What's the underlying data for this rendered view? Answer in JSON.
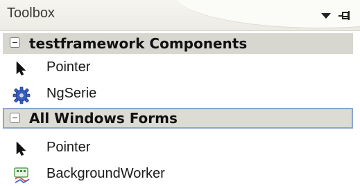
{
  "window": {
    "title": "Toolbox"
  },
  "groups": [
    {
      "label": "testframework Components",
      "items": [
        {
          "label": "Pointer",
          "icon": "pointer-arrow-icon"
        },
        {
          "label": "NgSerie",
          "icon": "gear-component-icon"
        }
      ]
    },
    {
      "label": "All Windows Forms",
      "selected": true,
      "items": [
        {
          "label": "Pointer",
          "icon": "pointer-arrow-icon"
        },
        {
          "label": "BackgroundWorker",
          "icon": "background-worker-icon"
        }
      ]
    }
  ],
  "colors": {
    "group_header_bg": "#d7d6cf",
    "selected_border": "#8aa6cf",
    "gear_blue": "#3b5fc4"
  }
}
